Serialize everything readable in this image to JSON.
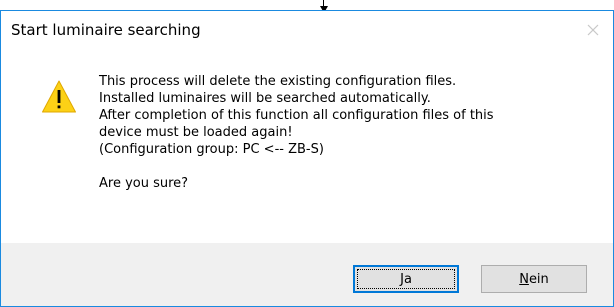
{
  "dialog": {
    "title": "Start luminaire searching",
    "icon": "warning-icon",
    "message_lines": [
      "This process will delete the existing configuration files.",
      "Installed luminaires will be searched automatically.",
      "After completion of this function all configuration files of this",
      "device must be loaded again!",
      "(Configuration group: PC <-- ZB-S)"
    ],
    "question": "Are you sure?",
    "buttons": {
      "yes": {
        "mnemonic": "J",
        "rest": "a"
      },
      "no": {
        "mnemonic": "N",
        "rest": "ein"
      }
    },
    "colors": {
      "border": "#1a8ae0",
      "footer_bg": "#f0f0f0",
      "default_button_border": "#0078d7",
      "warning_fill": "#fcd116"
    }
  }
}
